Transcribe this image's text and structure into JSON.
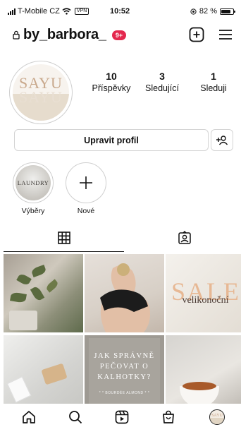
{
  "status_bar": {
    "carrier": "T-Mobile CZ",
    "vpn": "VPN",
    "time": "10:52",
    "battery": "82 %",
    "battery_level": 0.82
  },
  "header": {
    "username": "by_barbora_",
    "notification_badge": "9+"
  },
  "profile": {
    "avatar_logo": "SAYU",
    "stats": [
      {
        "value": "10",
        "label": "Příspěvky"
      },
      {
        "value": "3",
        "label": "Sledující"
      },
      {
        "value": "1",
        "label": "Sleduji"
      }
    ],
    "edit_button": "Upravit profil"
  },
  "highlights": [
    {
      "label": "Výběry",
      "cover_text": "LAUNDRY"
    },
    {
      "label": "Nové"
    }
  ],
  "tabs": [
    {
      "icon": "grid-icon",
      "active": true
    },
    {
      "icon": "tagged-icon",
      "active": false
    }
  ],
  "posts": {
    "tile3_title": "SALE",
    "tile3_subtitle": "velikonoční",
    "tile5_text": "JAK SPRÁVNĚ PEČOVAT O KALHOTKY?",
    "tile5_small": "* * BOURDÉE ALMOND * *"
  },
  "bottom_nav": [
    "home-icon",
    "search-icon",
    "reels-icon",
    "shop-icon",
    "profile-avatar"
  ],
  "colors": {
    "badge": "#e4284e",
    "text": "#111111",
    "border": "#d4d4d4",
    "sale_accent": "#e7b894"
  }
}
